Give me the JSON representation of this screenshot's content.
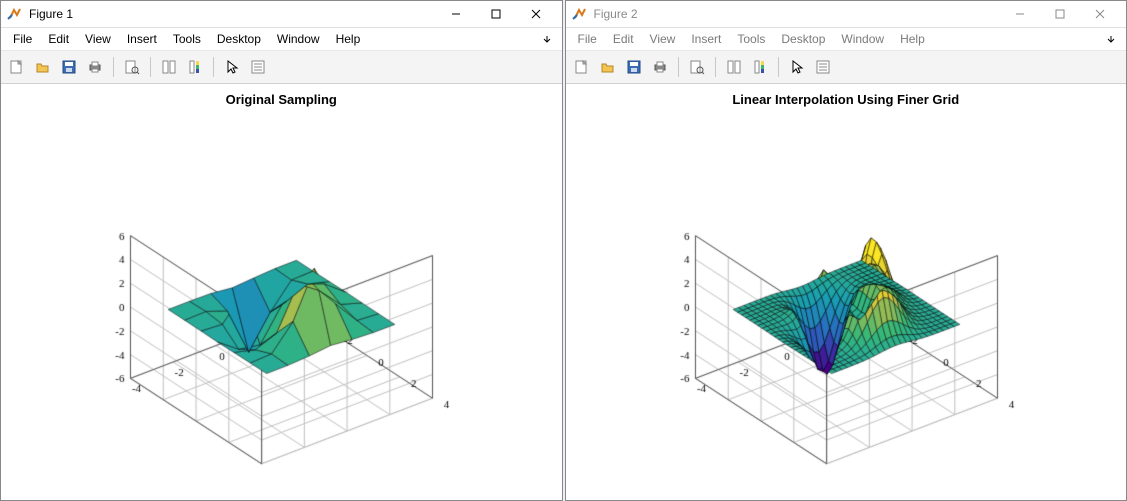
{
  "windows": [
    {
      "id": "fig1",
      "title": "Figure 1",
      "active": true,
      "plot_title": "Original Sampling"
    },
    {
      "id": "fig2",
      "title": "Figure 2",
      "active": false,
      "plot_title": "Linear Interpolation Using Finer Grid"
    }
  ],
  "menu": {
    "items": [
      "File",
      "Edit",
      "View",
      "Insert",
      "Tools",
      "Desktop",
      "Window",
      "Help"
    ]
  },
  "toolbar": {
    "groups": [
      [
        "new-figure-icon",
        "open-icon",
        "save-icon",
        "print-icon"
      ],
      [
        "print-preview-icon"
      ],
      [
        "link-axes-icon",
        "colorbar-icon"
      ],
      [
        "pointer-icon",
        "data-cursor-icon"
      ]
    ],
    "names": {
      "new-figure-icon": "New Figure",
      "open-icon": "Open",
      "save-icon": "Save",
      "print-icon": "Print",
      "print-preview-icon": "Print Preview",
      "link-axes-icon": "Link Axes",
      "colorbar-icon": "Insert Colorbar",
      "pointer-icon": "Edit Plot",
      "data-cursor-icon": "Data Cursor"
    }
  },
  "chart_data": [
    {
      "type": "surface",
      "title": "Original Sampling",
      "xlabel": "",
      "ylabel": "",
      "zlabel": "",
      "xlim": [
        -4,
        4
      ],
      "ylim": [
        -4,
        4
      ],
      "zlim": [
        -6,
        6
      ],
      "xticks": [
        -4,
        -2,
        0,
        2,
        4
      ],
      "yticks": [
        -4,
        -2,
        0,
        2,
        4
      ],
      "zticks": [
        -6,
        -4,
        -2,
        0,
        2,
        4,
        6
      ],
      "x": [
        -3,
        -2,
        -1,
        0,
        1,
        2,
        3
      ],
      "y": [
        -3,
        -2,
        -1,
        0,
        1,
        2,
        3
      ],
      "function": "peaks",
      "grid_step": 1
    },
    {
      "type": "surface",
      "title": "Linear Interpolation Using Finer Grid",
      "xlabel": "",
      "ylabel": "",
      "zlabel": "",
      "xlim": [
        -4,
        4
      ],
      "ylim": [
        -4,
        4
      ],
      "zlim": [
        -6,
        6
      ],
      "xticks": [
        -4,
        -2,
        0,
        2,
        4
      ],
      "yticks": [
        -4,
        -2,
        0,
        2,
        4
      ],
      "zticks": [
        -6,
        -4,
        -2,
        0,
        2,
        4,
        6
      ],
      "x_range": [
        -3,
        3
      ],
      "y_range": [
        -3,
        3
      ],
      "function": "peaks",
      "grid_step": 0.25
    }
  ],
  "colors": {
    "window_border": "#888888",
    "toolbar_bg": "#f4f4f4",
    "accent": "#0a50a1"
  }
}
